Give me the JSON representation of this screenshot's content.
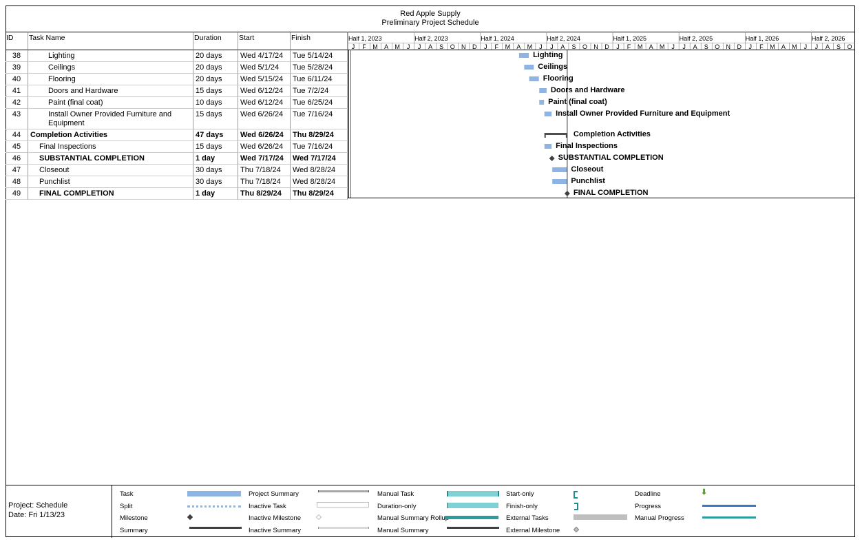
{
  "header": {
    "company": "Red Apple Supply",
    "subtitle": "Preliminary Project Schedule"
  },
  "columns": {
    "id": "ID",
    "task_name": "Task Name",
    "duration": "Duration",
    "start": "Start",
    "finish": "Finish"
  },
  "timeline": {
    "halves": [
      "Half 1, 2023",
      "Half 2, 2023",
      "Half 1, 2024",
      "Half 2, 2024",
      "Half 1, 2025",
      "Half 2, 2025",
      "Half 1, 2026",
      "Half 2, 2026"
    ],
    "months": [
      "J",
      "F",
      "M",
      "A",
      "M",
      "J",
      "J",
      "A",
      "S",
      "O",
      "N",
      "D",
      "J",
      "F",
      "M",
      "A",
      "M",
      "J",
      "J",
      "A",
      "S",
      "O",
      "N",
      "D",
      "J",
      "F",
      "M",
      "A",
      "M",
      "J",
      "J",
      "A",
      "S",
      "O",
      "N",
      "D",
      "J",
      "F",
      "M",
      "A",
      "M",
      "J",
      "J",
      "A",
      "S",
      "O"
    ],
    "start": "2023-01-01",
    "status_date": "2024-08-29",
    "colors": {
      "task": "#8db4e2",
      "summary": "#4d4d4d",
      "milestone": "#404040",
      "grid": "#7f7f7f"
    }
  },
  "tasks": [
    {
      "id": "38",
      "name": "Lighting",
      "duration": "20 days",
      "start": "Wed 4/17/24",
      "finish": "Tue 5/14/24",
      "indent": 2,
      "type": "task",
      "bar_label": "Lighting",
      "start_iso": "2024-04-17",
      "finish_iso": "2024-05-14"
    },
    {
      "id": "39",
      "name": "Ceilings",
      "duration": "20 days",
      "start": "Wed 5/1/24",
      "finish": "Tue 5/28/24",
      "indent": 2,
      "type": "task",
      "bar_label": "Ceilings",
      "start_iso": "2024-05-01",
      "finish_iso": "2024-05-28"
    },
    {
      "id": "40",
      "name": "Flooring",
      "duration": "20 days",
      "start": "Wed 5/15/24",
      "finish": "Tue 6/11/24",
      "indent": 2,
      "type": "task",
      "bar_label": "Flooring",
      "start_iso": "2024-05-15",
      "finish_iso": "2024-06-11"
    },
    {
      "id": "41",
      "name": "Doors and Hardware",
      "duration": "15 days",
      "start": "Wed 6/12/24",
      "finish": "Tue 7/2/24",
      "indent": 2,
      "type": "task",
      "bar_label": "Doors and Hardware",
      "start_iso": "2024-06-12",
      "finish_iso": "2024-07-02"
    },
    {
      "id": "42",
      "name": "Paint (final coat)",
      "duration": "10 days",
      "start": "Wed 6/12/24",
      "finish": "Tue 6/25/24",
      "indent": 2,
      "type": "task",
      "bar_label": "Paint (final coat)",
      "start_iso": "2024-06-12",
      "finish_iso": "2024-06-25"
    },
    {
      "id": "43",
      "name": "Install Owner Provided Furniture and",
      "name2": "Equipment",
      "duration": "15 days",
      "start": "Wed 6/26/24",
      "finish": "Tue 7/16/24",
      "indent": 2,
      "type": "task",
      "bar_label": "Install Owner Provided Furniture and Equipment",
      "start_iso": "2024-06-26",
      "finish_iso": "2024-07-16",
      "tall": true
    },
    {
      "id": "44",
      "name": "Completion Activities",
      "duration": "47 days",
      "start": "Wed 6/26/24",
      "finish": "Thu 8/29/24",
      "indent": 0,
      "type": "summary",
      "bar_label": "Completion Activities",
      "start_iso": "2024-06-26",
      "finish_iso": "2024-08-29"
    },
    {
      "id": "45",
      "name": "Final Inspections",
      "duration": "15 days",
      "start": "Wed 6/26/24",
      "finish": "Tue 7/16/24",
      "indent": 1,
      "type": "task",
      "bar_label": "Final Inspections",
      "start_iso": "2024-06-26",
      "finish_iso": "2024-07-16"
    },
    {
      "id": "46",
      "name": "SUBSTANTIAL COMPLETION",
      "duration": "1 day",
      "start": "Wed 7/17/24",
      "finish": "Wed 7/17/24",
      "indent": 1,
      "type": "milestone",
      "bar_label": "SUBSTANTIAL COMPLETION",
      "start_iso": "2024-07-17",
      "finish_iso": "2024-07-17"
    },
    {
      "id": "47",
      "name": "Closeout",
      "duration": "30 days",
      "start": "Thu 7/18/24",
      "finish": "Wed 8/28/24",
      "indent": 1,
      "type": "task",
      "bar_label": "Closeout",
      "start_iso": "2024-07-18",
      "finish_iso": "2024-08-28"
    },
    {
      "id": "48",
      "name": "Punchlist",
      "duration": "30 days",
      "start": "Thu 7/18/24",
      "finish": "Wed 8/28/24",
      "indent": 1,
      "type": "task",
      "bar_label": "Punchlist",
      "start_iso": "2024-07-18",
      "finish_iso": "2024-08-28"
    },
    {
      "id": "49",
      "name": "FINAL COMPLETION",
      "duration": "1 day",
      "start": "Thu 8/29/24",
      "finish": "Thu 8/29/24",
      "indent": 1,
      "type": "milestone",
      "bar_label": "FINAL COMPLETION",
      "start_iso": "2024-08-29",
      "finish_iso": "2024-08-29"
    }
  ],
  "footer": {
    "project": "Project: Schedule",
    "date": "Date: Fri 1/13/23"
  },
  "legend": {
    "task": "Task",
    "split": "Split",
    "milestone": "Milestone",
    "summary": "Summary",
    "project_summary": "Project Summary",
    "inactive_task": "Inactive Task",
    "inactive_milestone": "Inactive Milestone",
    "inactive_summary": "Inactive Summary",
    "manual_task": "Manual Task",
    "duration_only": "Duration-only",
    "manual_summary_rollup": "Manual Summary Rollup",
    "manual_summary": "Manual Summary",
    "start_only": "Start-only",
    "finish_only": "Finish-only",
    "external_tasks": "External Tasks",
    "external_milestone": "External Milestone",
    "deadline": "Deadline",
    "progress": "Progress",
    "manual_progress": "Manual Progress"
  }
}
